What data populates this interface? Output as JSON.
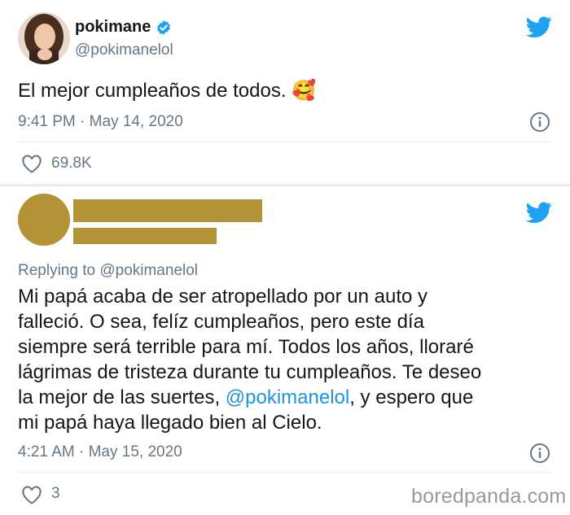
{
  "tweet1": {
    "display_name": "pokimane",
    "handle": "@pokimanelol",
    "text": "El mejor cumpleaños de todos.",
    "emoji": "🥰",
    "timestamp": "9:41 PM · May 14, 2020",
    "likes": "69.8K"
  },
  "tweet2": {
    "replying_to": "Replying to @pokimanelol",
    "text_line_1": "Mi papá acaba de ser atropellado por un auto y",
    "text_line_2": "falleció. O sea, felíz cumpleaños, pero este día",
    "text_line_3": "siempre será terrible para mí. Todos los años, lloraré",
    "text_line_4": "lágrimas de tristeza durante tu cumpleaños. Te deseo",
    "text_line_5_pre": "la mejor de las suertes, ",
    "mention": "@pokimanelol",
    "text_line_5_post": ", y espero que",
    "text_line_6": "mi papá haya llegado bien al Cielo.",
    "timestamp": "4:21 AM · May 15, 2020",
    "likes": "3"
  },
  "watermark": "boredpanda.com",
  "colors": {
    "twitter_blue": "#1da1f2",
    "mention_blue": "#1b95e0",
    "redaction_gold": "#b39335",
    "meta_gray": "#657786"
  },
  "icons": [
    "verified-badge-icon",
    "twitter-bird-icon",
    "info-icon",
    "heart-icon"
  ]
}
